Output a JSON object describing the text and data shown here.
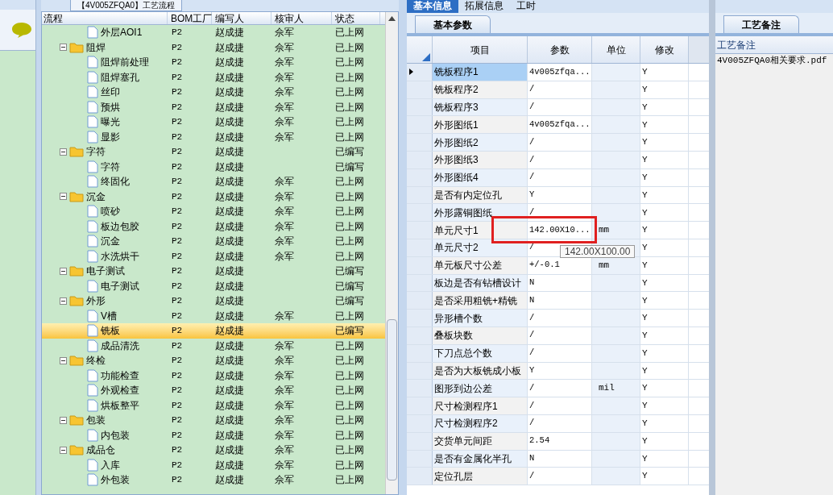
{
  "process_tab": {
    "label": "【4V005ZFQA0】工艺流程"
  },
  "tree": {
    "columns": [
      "流程",
      "BOM工厂",
      "编写人",
      "核审人",
      "状态"
    ],
    "items": [
      {
        "kind": "file",
        "name": "外层AOI1",
        "factory": "P2",
        "author": "赵成捷",
        "reviewer": "佘军",
        "status": "已上网",
        "selected": false
      },
      {
        "kind": "folder",
        "name": "阻焊",
        "factory": "P2",
        "author": "赵成捷",
        "reviewer": "佘军",
        "status": "已上网",
        "selected": false,
        "expanded": true,
        "children": [
          {
            "kind": "file",
            "name": "阻焊前处理",
            "factory": "P2",
            "author": "赵成捷",
            "reviewer": "佘军",
            "status": "已上网",
            "selected": false
          },
          {
            "kind": "file",
            "name": "阻焊塞孔",
            "factory": "P2",
            "author": "赵成捷",
            "reviewer": "佘军",
            "status": "已上网",
            "selected": false
          },
          {
            "kind": "file",
            "name": "丝印",
            "factory": "P2",
            "author": "赵成捷",
            "reviewer": "佘军",
            "status": "已上网",
            "selected": false
          },
          {
            "kind": "file",
            "name": "预烘",
            "factory": "P2",
            "author": "赵成捷",
            "reviewer": "佘军",
            "status": "已上网",
            "selected": false
          },
          {
            "kind": "file",
            "name": "曝光",
            "factory": "P2",
            "author": "赵成捷",
            "reviewer": "佘军",
            "status": "已上网",
            "selected": false
          },
          {
            "kind": "file",
            "name": "显影",
            "factory": "P2",
            "author": "赵成捷",
            "reviewer": "佘军",
            "status": "已上网",
            "selected": false
          }
        ]
      },
      {
        "kind": "folder",
        "name": "字符",
        "factory": "P2",
        "author": "赵成捷",
        "status": "已编写",
        "selected": false,
        "expanded": true,
        "children": [
          {
            "kind": "file",
            "name": "字符",
            "factory": "P2",
            "author": "赵成捷",
            "status": "已编写",
            "selected": false
          },
          {
            "kind": "file",
            "name": "终固化",
            "factory": "P2",
            "author": "赵成捷",
            "reviewer": "佘军",
            "status": "已上网",
            "selected": false
          }
        ]
      },
      {
        "kind": "folder",
        "name": "沉金",
        "factory": "P2",
        "author": "赵成捷",
        "reviewer": "佘军",
        "status": "已上网",
        "selected": false,
        "expanded": true,
        "children": [
          {
            "kind": "file",
            "name": "喷砂",
            "factory": "P2",
            "author": "赵成捷",
            "reviewer": "佘军",
            "status": "已上网",
            "selected": false
          },
          {
            "kind": "file",
            "name": "板边包胶",
            "factory": "P2",
            "author": "赵成捷",
            "reviewer": "佘军",
            "status": "已上网",
            "selected": false
          },
          {
            "kind": "file",
            "name": "沉金",
            "factory": "P2",
            "author": "赵成捷",
            "reviewer": "佘军",
            "status": "已上网",
            "selected": false
          },
          {
            "kind": "file",
            "name": "水洗烘干",
            "factory": "P2",
            "author": "赵成捷",
            "reviewer": "佘军",
            "status": "已上网",
            "selected": false
          }
        ]
      },
      {
        "kind": "folder",
        "name": "电子测试",
        "factory": "P2",
        "author": "赵成捷",
        "status": "已编写",
        "selected": false,
        "expanded": true,
        "children": [
          {
            "kind": "file",
            "name": "电子测试",
            "factory": "P2",
            "author": "赵成捷",
            "status": "已编写",
            "selected": false
          }
        ]
      },
      {
        "kind": "folder",
        "name": "外形",
        "factory": "P2",
        "author": "赵成捷",
        "status": "已编写",
        "selected": false,
        "expanded": true,
        "children": [
          {
            "kind": "file",
            "name": "V槽",
            "factory": "P2",
            "author": "赵成捷",
            "reviewer": "佘军",
            "status": "已上网",
            "selected": false
          },
          {
            "kind": "file",
            "name": "铣板",
            "factory": "P2",
            "author": "赵成捷",
            "status": "已编写",
            "selected": true
          },
          {
            "kind": "file",
            "name": "成品清洗",
            "factory": "P2",
            "author": "赵成捷",
            "reviewer": "佘军",
            "status": "已上网",
            "selected": false
          }
        ]
      },
      {
        "kind": "folder",
        "name": "终检",
        "factory": "P2",
        "author": "赵成捷",
        "reviewer": "佘军",
        "status": "已上网",
        "selected": false,
        "expanded": true,
        "children": [
          {
            "kind": "file",
            "name": "功能检查",
            "factory": "P2",
            "author": "赵成捷",
            "reviewer": "佘军",
            "status": "已上网",
            "selected": false
          },
          {
            "kind": "file",
            "name": "外观检查",
            "factory": "P2",
            "author": "赵成捷",
            "reviewer": "佘军",
            "status": "已上网",
            "selected": false
          },
          {
            "kind": "file",
            "name": "烘板整平",
            "factory": "P2",
            "author": "赵成捷",
            "reviewer": "佘军",
            "status": "已上网",
            "selected": false
          }
        ]
      },
      {
        "kind": "folder",
        "name": "包装",
        "factory": "P2",
        "author": "赵成捷",
        "reviewer": "佘军",
        "status": "已上网",
        "selected": false,
        "expanded": true,
        "children": [
          {
            "kind": "file",
            "name": "内包装",
            "factory": "P2",
            "author": "赵成捷",
            "reviewer": "佘军",
            "status": "已上网",
            "selected": false
          }
        ]
      },
      {
        "kind": "folder",
        "name": "成品仓",
        "factory": "P2",
        "author": "赵成捷",
        "reviewer": "佘军",
        "status": "已上网",
        "selected": false,
        "expanded": true,
        "children": [
          {
            "kind": "file",
            "name": "入库",
            "factory": "P2",
            "author": "赵成捷",
            "reviewer": "佘军",
            "status": "已上网",
            "selected": false
          },
          {
            "kind": "file",
            "name": "外包装",
            "factory": "P2",
            "author": "赵成捷",
            "reviewer": "佘军",
            "status": "已上网",
            "selected": false
          }
        ]
      }
    ]
  },
  "main_tabs": [
    {
      "label": "基本信息",
      "selected": true
    },
    {
      "label": "拓展信息",
      "selected": false
    },
    {
      "label": "工时",
      "selected": false
    }
  ],
  "sub_tab": {
    "label": "基本参数"
  },
  "params": {
    "columns": [
      "项目",
      "参数",
      "单位",
      "修改"
    ],
    "rows": [
      {
        "item": "铣板程序1",
        "value": "4v005zfqa...",
        "modify": "Y",
        "selected": true
      },
      {
        "item": "铣板程序2",
        "value": "/",
        "modify": "Y",
        "selected": false
      },
      {
        "item": "铣板程序3",
        "value": "/",
        "modify": "Y",
        "selected": false
      },
      {
        "item": "外形图纸1",
        "value": "4v005zfqa...",
        "modify": "Y",
        "selected": false
      },
      {
        "item": "外形图纸2",
        "value": "/",
        "modify": "Y",
        "selected": false
      },
      {
        "item": "外形图纸3",
        "value": "/",
        "modify": "Y",
        "selected": false
      },
      {
        "item": "外形图纸4",
        "value": "/",
        "modify": "Y",
        "selected": false
      },
      {
        "item": "是否有内定位孔",
        "value": "Y",
        "modify": "Y",
        "selected": false
      },
      {
        "item": "外形露铜图纸",
        "value": "/",
        "modify": "Y",
        "selected": false
      },
      {
        "item": "单元尺寸1",
        "value": "142.00X10...",
        "unit": "mm",
        "modify": "Y",
        "selected": false,
        "highlighted": true
      },
      {
        "item": "单元尺寸2",
        "value": "/",
        "modify": "Y",
        "selected": false
      },
      {
        "item": "单元板尺寸公差",
        "value": "+/-0.1",
        "unit": "mm",
        "modify": "Y",
        "selected": false
      },
      {
        "item": "板边是否有钻槽设计",
        "value": "N",
        "modify": "Y",
        "selected": false
      },
      {
        "item": "是否采用粗铣+精铣",
        "value": "N",
        "modify": "Y",
        "selected": false
      },
      {
        "item": "异形槽个数",
        "value": "/",
        "modify": "Y",
        "selected": false
      },
      {
        "item": "叠板块数",
        "value": "/",
        "modify": "Y",
        "selected": false
      },
      {
        "item": "下刀点总个数",
        "value": "/",
        "modify": "Y",
        "selected": false
      },
      {
        "item": "是否为大板铣成小板",
        "value": "Y",
        "modify": "Y",
        "selected": false
      },
      {
        "item": "图形到边公差",
        "value": "/",
        "unit": "mil",
        "modify": "Y",
        "selected": false
      },
      {
        "item": "尺寸检测程序1",
        "value": "/",
        "modify": "Y",
        "selected": false
      },
      {
        "item": "尺寸检测程序2",
        "value": "/",
        "modify": "Y",
        "selected": false
      },
      {
        "item": "交货单元间距",
        "value": "2.54",
        "modify": "Y",
        "selected": false
      },
      {
        "item": "是否有金属化半孔",
        "value": "N",
        "modify": "Y",
        "selected": false
      },
      {
        "item": "定位孔层",
        "value": "/",
        "modify": "Y",
        "selected": false
      }
    ]
  },
  "tooltip": {
    "text": "142.00X100.00"
  },
  "notes": {
    "tab": "工艺备注",
    "header": "工艺备注",
    "files": [
      "4V005ZFQA0相关要求.pdf"
    ]
  }
}
